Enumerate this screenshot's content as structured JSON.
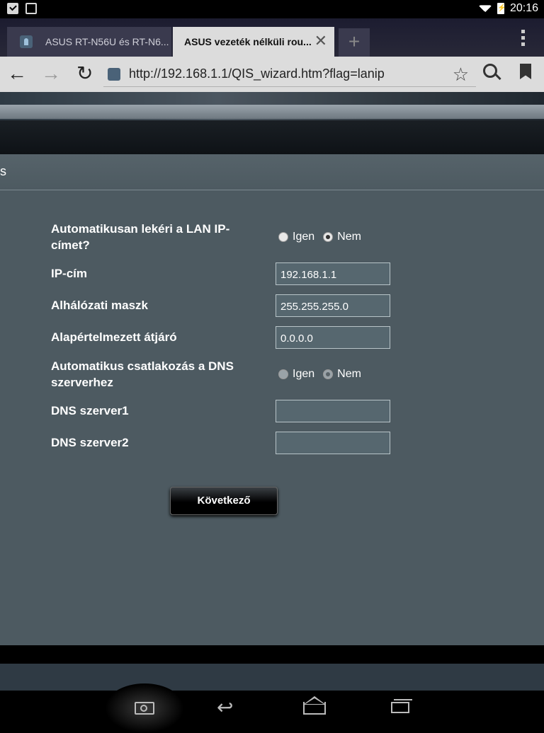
{
  "status_bar": {
    "time": "20:16"
  },
  "browser": {
    "tabs": [
      {
        "title": "ASUS RT-N56U és RT-N6...",
        "active": false
      },
      {
        "title": "ASUS vezeték nélküli rou...",
        "active": true
      }
    ],
    "url": "http://192.168.1.1/QIS_wizard.htm?flag=lanip"
  },
  "page": {
    "section_title": "s",
    "form": {
      "auto_lan_ip": {
        "label": "Automatikusan lekéri a LAN IP-címet?",
        "options": [
          "Igen",
          "Nem"
        ],
        "selected": "Nem"
      },
      "ip_address": {
        "label": "IP-cím",
        "value": "192.168.1.1"
      },
      "subnet_mask": {
        "label": "Alhálózati maszk",
        "value": "255.255.255.0"
      },
      "default_gateway": {
        "label": "Alapértelmezett átjáró",
        "value": "0.0.0.0"
      },
      "auto_dns": {
        "label": "Automatikus csatlakozás a DNS szerverhez",
        "options": [
          "Igen",
          "Nem"
        ],
        "selected": "Nem",
        "disabled": true
      },
      "dns1": {
        "label": "DNS szerver1",
        "value": ""
      },
      "dns2": {
        "label": "DNS szerver2",
        "value": ""
      }
    },
    "next_button": "Következő"
  },
  "icons": {
    "status_left": [
      "check-icon",
      "image-icon"
    ],
    "status_right": [
      "wifi-icon",
      "battery-charging-icon"
    ],
    "toolbar": [
      "back-icon",
      "forward-icon",
      "reload-icon",
      "site-favicon",
      "star-icon",
      "search-icon",
      "bookmarks-icon",
      "overflow-menu-icon"
    ],
    "system_nav": [
      "screenshot-camera-icon",
      "back-icon",
      "home-icon",
      "recent-apps-icon"
    ]
  }
}
